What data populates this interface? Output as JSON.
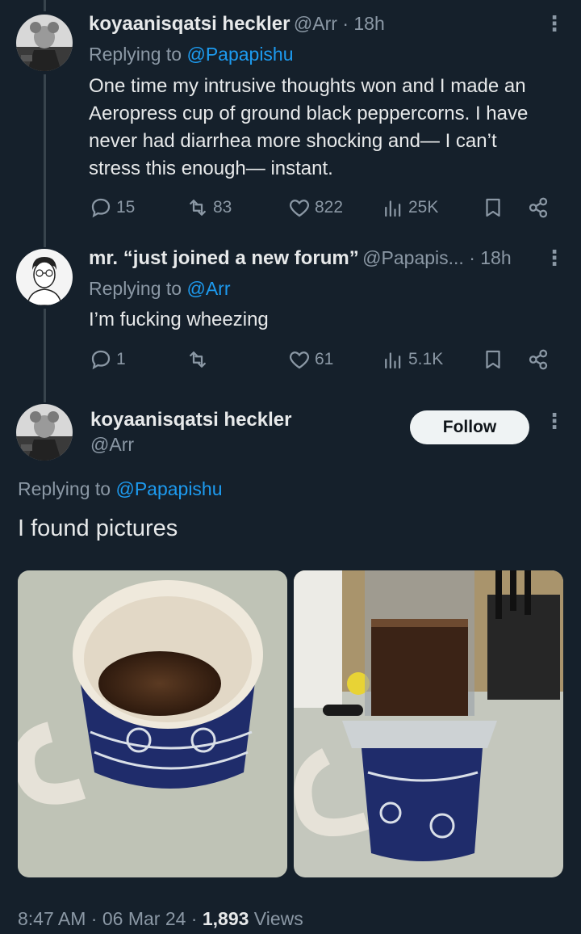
{
  "tweets": [
    {
      "name": "koyaanisqatsi heckler",
      "handle": "@Arr",
      "sep": " · ",
      "time": "18h",
      "replying_prefix": "Replying to ",
      "replying_to": "@Papapishu",
      "lines": [
        "One time my intrusive thoughts won and I made an",
        "Aeropress cup of ground black peppercorns. I have",
        "never had diarrhea more shocking and— I can’t",
        "stress this enough— instant."
      ],
      "stats": {
        "replies": "15",
        "retweets": "83",
        "likes": "822",
        "views": "25K"
      }
    },
    {
      "name": "mr. “just joined a new forum”",
      "handle": "@Papapis...",
      "sep": " · ",
      "time": "18h",
      "replying_prefix": "Replying to ",
      "replying_to": "@Arr",
      "lines": [
        "I’m fucking wheezing"
      ],
      "stats": {
        "replies": "1",
        "retweets": "",
        "likes": "61",
        "views": "5.1K"
      }
    }
  ],
  "main": {
    "name": "koyaanisqatsi heckler",
    "handle": "@Arr",
    "follow_label": "Follow",
    "replying_prefix": "Replying to ",
    "replying_to": "@Papapishu",
    "text": "I found pictures",
    "time": "8:47 AM",
    "date": "06 Mar 24",
    "sep": " · ",
    "views_count": "1,893",
    "views_label": " Views"
  },
  "icons": {
    "reply": "reply-icon",
    "retweet": "retweet-icon",
    "like": "heart-icon",
    "views": "views-icon",
    "bookmark": "bookmark-icon",
    "share": "share-icon",
    "more": "more-icon"
  },
  "colors": {
    "background": "#15202b",
    "link": "#1d9bf0",
    "muted": "#8b98a5",
    "text": "#e7e9ea"
  }
}
